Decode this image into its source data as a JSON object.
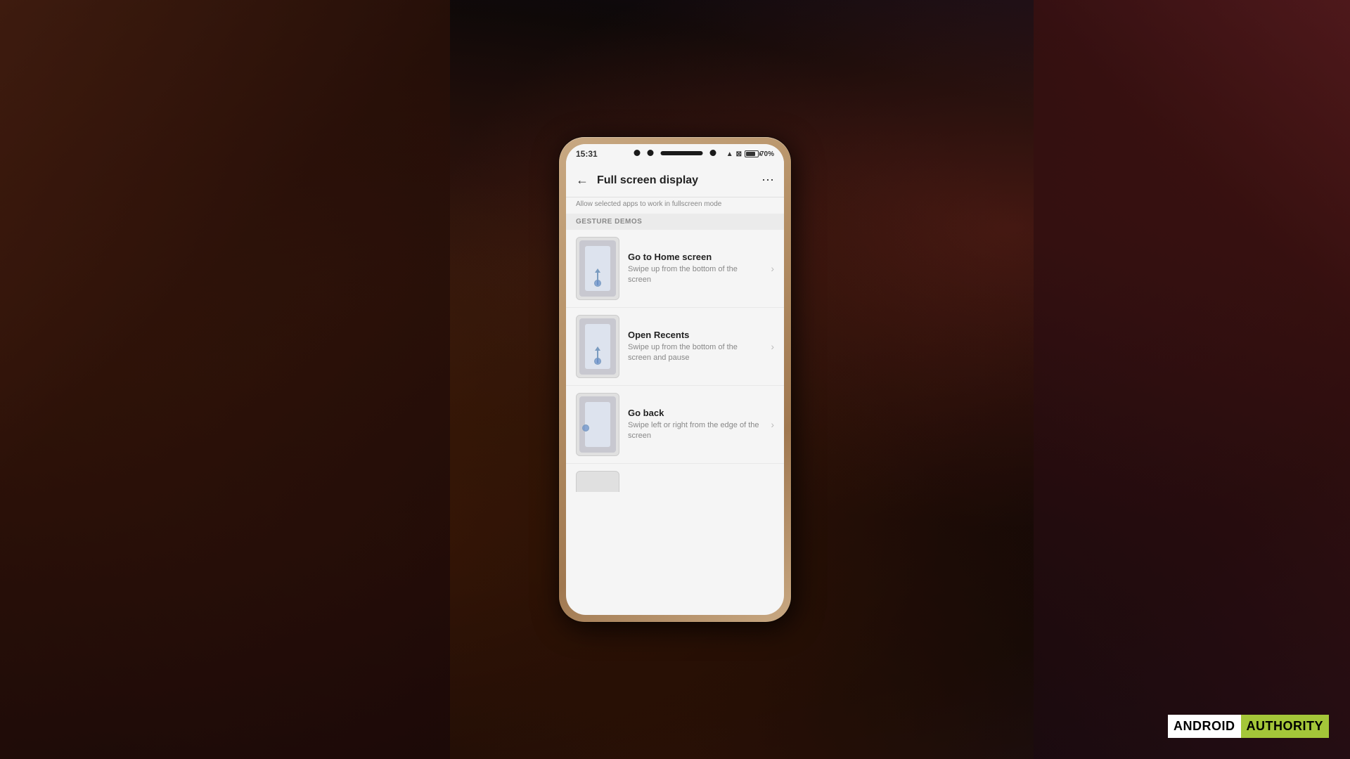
{
  "background": {
    "description": "Dark room background with a hand holding a phone"
  },
  "watermark": {
    "android": "ANDROID",
    "authority": "AUTHORITY"
  },
  "phone": {
    "status_bar": {
      "time": "15:31",
      "battery_percent": "70%",
      "icons": [
        "wifi",
        "signal",
        "battery"
      ]
    },
    "app_bar": {
      "title": "Full screen display",
      "back_label": "←",
      "more_label": "⋯"
    },
    "subtitle": "Allow selected apps to work in fullscreen mode",
    "section_header": "GESTURE DEMOS",
    "gesture_items": [
      {
        "id": "home",
        "title": "Go to Home screen",
        "description": "Swipe up from the bottom of the screen"
      },
      {
        "id": "recents",
        "title": "Open Recents",
        "description": "Swipe up from the bottom of the screen and pause"
      },
      {
        "id": "back",
        "title": "Go back",
        "description": "Swipe left or right from the edge of the screen"
      }
    ]
  }
}
